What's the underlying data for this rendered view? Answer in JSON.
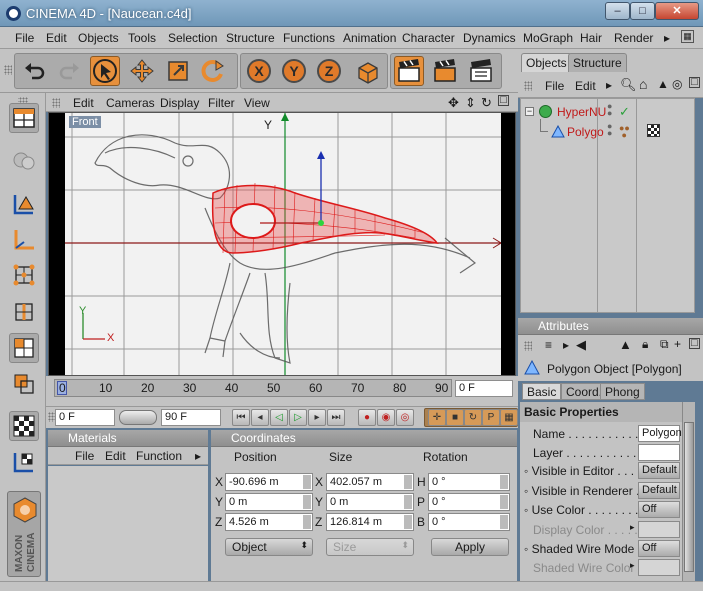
{
  "window": {
    "title": "CINEMA 4D - [Naucean.c4d]",
    "min": "–",
    "max": "□",
    "close": "✕"
  },
  "menubar": [
    "File",
    "Edit",
    "Objects",
    "Tools",
    "Selection",
    "Structure",
    "Functions",
    "Animation",
    "Character",
    "Dynamics",
    "MoGraph",
    "Hair",
    "Render"
  ],
  "toolbar": {
    "axes": [
      "X",
      "Y",
      "Z"
    ],
    "icons": [
      "undo-icon",
      "redo-icon",
      "select-pointer-icon",
      "move-icon",
      "scale-icon",
      "rotate-icon",
      "axis-x-icon",
      "axis-y-icon",
      "axis-z-icon",
      "coordinate-system-icon",
      "render-view-icon",
      "render-picture-icon",
      "render-settings-icon"
    ]
  },
  "viewport": {
    "menu": [
      "Edit",
      "Cameras",
      "Display",
      "Filter",
      "View"
    ],
    "label": "Front",
    "axis_y": "Y",
    "axis_x_small": "X",
    "axis_y_small": "Y"
  },
  "timeline": {
    "ticks": [
      "0",
      "10",
      "20",
      "30",
      "40",
      "50",
      "60",
      "70",
      "80",
      "90"
    ],
    "current_frame": "0 F",
    "start_frame": "0 F",
    "end_frame": "90 F"
  },
  "materials": {
    "title": "Materials",
    "menu": [
      "File",
      "Edit",
      "Function"
    ]
  },
  "coordinates": {
    "title": "Coordinates",
    "headers": [
      "Position",
      "Size",
      "Rotation"
    ],
    "rows": [
      {
        "axis": "X",
        "pos": "-90.696 m",
        "size_axis": "X",
        "size": "402.057 m",
        "rot_axis": "H",
        "rot": "0 °"
      },
      {
        "axis": "Y",
        "pos": "0 m",
        "size_axis": "Y",
        "size": "0 m",
        "rot_axis": "P",
        "rot": "0 °"
      },
      {
        "axis": "Z",
        "pos": "4.526 m",
        "size_axis": "Z",
        "size": "126.814 m",
        "rot_axis": "B",
        "rot": "0 °"
      }
    ],
    "mode": "Object",
    "size_mode": "Size",
    "apply": "Apply"
  },
  "objects": {
    "tabs": [
      "Objects",
      "Structure"
    ],
    "menu": [
      "File",
      "Edit"
    ],
    "items": [
      {
        "name": "HyperNU",
        "icon": "hypernurbs-icon"
      },
      {
        "name": "Polygo",
        "icon": "polygon-icon"
      }
    ]
  },
  "attributes": {
    "title": "Attributes",
    "object_title": "Polygon Object [Polygon]",
    "tabs": [
      "Basic",
      "Coord.",
      "Phong"
    ],
    "section": "Basic Properties",
    "fields": [
      {
        "label": "Name . . . . . . . . . . . .",
        "value": "Polygon"
      },
      {
        "label": "Layer . . . . . . . . . . . .",
        "value": ""
      },
      {
        "label": "Visible in Editor . . . .",
        "value": "Default"
      },
      {
        "label": "Visible in Renderer . .",
        "value": "Default"
      },
      {
        "label": "Use Color . . . . . . . .",
        "value": "Off"
      },
      {
        "label": "Display Color . . . . . .",
        "value": ""
      },
      {
        "label": "Shaded Wire Mode",
        "value": "Off"
      },
      {
        "label": "Shaded Wire Color . .",
        "value": ""
      }
    ]
  },
  "colors": {
    "accent": "#e7903c",
    "mesh": "#dd1a1a",
    "panel": "#c3c3c3"
  }
}
